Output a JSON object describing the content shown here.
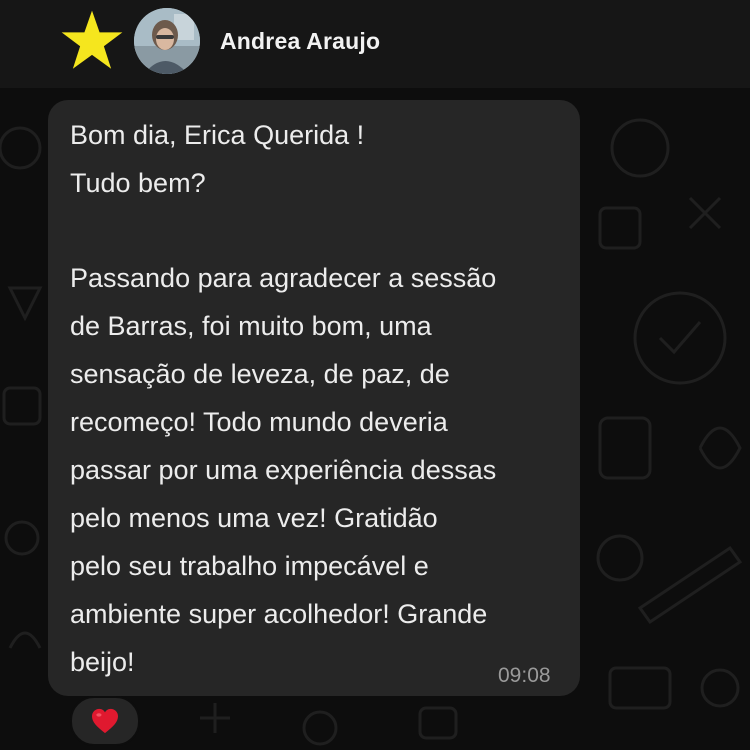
{
  "header": {
    "contact_name": "Andrea Araujo"
  },
  "message": {
    "lines": [
      "Bom dia, Erica Querida !",
      "Tudo bem?",
      "Passando para agradecer a sessão",
      "de Barras, foi muito bom,  uma",
      "sensação de leveza, de paz,  de",
      "recomeço!  Todo mundo deveria",
      "passar por uma experiência dessas",
      "pelo menos uma vez! Gratidão",
      "pelo seu trabalho impecável e",
      "ambiente super acolhedor! Grande",
      "beijo!"
    ],
    "time": "09:08"
  },
  "reaction": {
    "icon": "red-heart-icon",
    "color": "#e0192f"
  },
  "icons": {
    "star": "star-icon",
    "star_color": "#f5e61e"
  }
}
